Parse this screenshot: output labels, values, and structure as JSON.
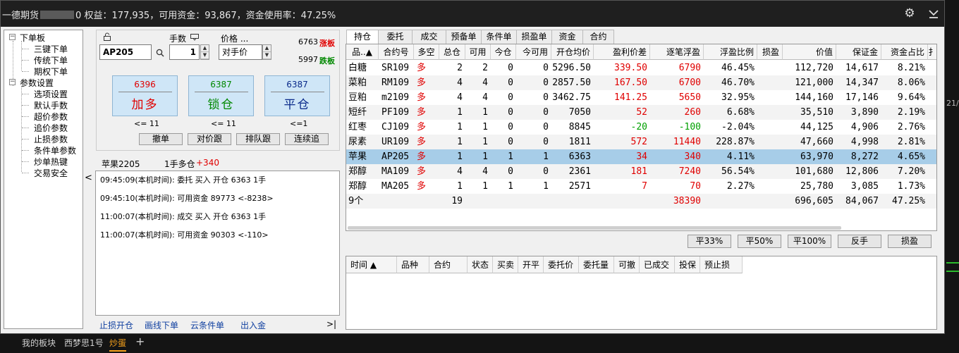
{
  "titlebar": {
    "broker": "一德期货",
    "masked_suffix": "0",
    "summary": "权益：177,935，可用资金：93,867，资金使用率：47.25%",
    "settings_icon": "gear-icon",
    "collapse_icon": "chevron-down-icon"
  },
  "tree": {
    "root1": "下单板",
    "root1_children": [
      "三键下单",
      "传统下单",
      "期权下单"
    ],
    "root2": "参数设置",
    "root2_children": [
      "选项设置",
      "默认手数",
      "超价参数",
      "追价参数",
      "止损参数",
      "条件单参数",
      "炒单热键",
      "交易安全"
    ]
  },
  "order": {
    "lots_label": "手数",
    "price_label": "价格 ...",
    "contract": "AP205",
    "lots": "1",
    "price_mode": "对手价",
    "limit_up": "6763",
    "limit_up_label": "涨板",
    "limit_down": "5997",
    "limit_down_label": "跌板",
    "buttons": [
      {
        "price": "6396",
        "label": "加多",
        "cap": "<= 11",
        "color": "#e00000"
      },
      {
        "price": "6387",
        "label": "锁仓",
        "cap": "<= 11",
        "color": "#008800"
      },
      {
        "price": "6387",
        "label": "平仓",
        "cap": "<=1",
        "color": "#0a2a8a"
      }
    ],
    "actions": [
      "撤单",
      "对价跟",
      "排队跟",
      "连续追"
    ]
  },
  "position_info": {
    "name": "苹果2205",
    "summary": "1手多仓",
    "pnl": "+340"
  },
  "log": [
    "09:45:09(本机时间): 委托 买入 开仓 6363 1手",
    "09:45:10(本机时间): 可用资金 89773 <-8238>",
    "11:00:07(本机时间): 成交 买入 开仓 6363 1手",
    "11:00:07(本机时间): 可用资金 90303 <-110>"
  ],
  "links": [
    "止损开仓",
    "画线下单",
    "云条件单",
    "出入金"
  ],
  "log_next": ">|",
  "tabs": [
    "持仓",
    "委托",
    "成交",
    "预备单",
    "条件单",
    "损盈单",
    "资金",
    "合约"
  ],
  "positions": {
    "headers": [
      "品..▲",
      "合约号",
      "多空",
      "总仓",
      "可用",
      "今仓",
      "今可用",
      "开仓均价",
      "盈利价差",
      "逐笔浮盈",
      "浮盈比例",
      "损盈",
      "价值",
      "保证金",
      "资金占比",
      "扌"
    ],
    "rows": [
      [
        "白糖",
        "SR109",
        "多",
        "2",
        "2",
        "0",
        "0",
        "5296.50",
        "339.50",
        "6790",
        "46.45%",
        "",
        "112,720",
        "14,617",
        "8.21%"
      ],
      [
        "菜粕",
        "RM109",
        "多",
        "4",
        "4",
        "0",
        "0",
        "2857.50",
        "167.50",
        "6700",
        "46.70%",
        "",
        "121,000",
        "14,347",
        "8.06%"
      ],
      [
        "豆粕",
        "m2109",
        "多",
        "4",
        "4",
        "0",
        "0",
        "3462.75",
        "141.25",
        "5650",
        "32.95%",
        "",
        "144,160",
        "17,146",
        "9.64%"
      ],
      [
        "短纤",
        "PF109",
        "多",
        "1",
        "1",
        "0",
        "0",
        "7050",
        "52",
        "260",
        "6.68%",
        "",
        "35,510",
        "3,890",
        "2.19%"
      ],
      [
        "红枣",
        "CJ109",
        "多",
        "1",
        "1",
        "0",
        "0",
        "8845",
        "-20",
        "-100",
        "-2.04%",
        "",
        "44,125",
        "4,906",
        "2.76%"
      ],
      [
        "尿素",
        "UR109",
        "多",
        "1",
        "1",
        "0",
        "0",
        "1811",
        "572",
        "11440",
        "228.87%",
        "",
        "47,660",
        "4,998",
        "2.81%"
      ],
      [
        "苹果",
        "AP205",
        "多",
        "1",
        "1",
        "1",
        "1",
        "6363",
        "34",
        "340",
        "4.11%",
        "",
        "63,970",
        "8,272",
        "4.65%"
      ],
      [
        "郑醇",
        "MA109",
        "多",
        "4",
        "4",
        "0",
        "0",
        "2361",
        "181",
        "7240",
        "56.54%",
        "",
        "101,680",
        "12,806",
        "7.20%"
      ],
      [
        "郑醇",
        "MA205",
        "多",
        "1",
        "1",
        "1",
        "1",
        "2571",
        "7",
        "70",
        "2.27%",
        "",
        "25,780",
        "3,085",
        "1.73%"
      ]
    ],
    "total": [
      "9个",
      "",
      "",
      "19",
      "",
      "",
      "",
      "",
      "",
      "38390",
      "",
      "",
      "696,605",
      "84,067",
      "47.25%"
    ]
  },
  "position_actions": [
    "平33%",
    "平50%",
    "平100%",
    "反手",
    "损盈"
  ],
  "orders": {
    "headers": [
      "时间 ▲",
      "品种",
      "合约",
      "状态",
      "买卖",
      "开平",
      "委托价",
      "委托量",
      "可撤",
      "已成交",
      "投保",
      "预止损"
    ]
  },
  "right_edge": "21/",
  "taskbar": [
    "我的板块",
    "西梦思1号",
    "炒蛋",
    "+"
  ],
  "colors": {
    "profit": "#e00000",
    "loss": "#00a000",
    "selected_row": "#a7cde8",
    "accent": "#f7a21b"
  }
}
